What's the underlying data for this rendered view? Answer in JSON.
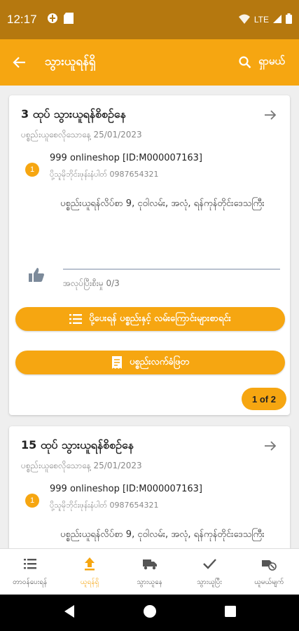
{
  "status_bar": {
    "time": "12:17",
    "network": "LTE"
  },
  "app_bar": {
    "title": "သွားယူရန်ရှိ",
    "search_label": "ရှာမယ်"
  },
  "cards": [
    {
      "title": "3 ထုပ် သွားယူရန်စိစဉ်နေ",
      "date": "ပစ္စည်းယူစေလိုသောနေ့ 25/01/2023",
      "item_number": "1",
      "shop": "999 onlineshop [ID:M000007163]",
      "phone": "ပို့သူမိုဘိုင်းဖုန်းနံပါတ် 0987654321",
      "address": "ပစ္စည်းယူရန်လိပ်စာ 9, ငုဝါလမ်း, အလုံ, ရန်ကုန်တိုင်းဒေသကြီး",
      "progress_label": "အလုပ်ပြီးစီးမှု 0/3",
      "button_list": "ပို့ပေးရန် ပစ္စည်းနှင့် လမ်းကြောင်းများစာရင်း",
      "button_receipt": "ပစ္စည်းလက်ခံဖြတ",
      "page_indicator": "1 of 2"
    },
    {
      "title": "15 ထုပ် သွားယူရန်စိစဉ်နေ",
      "date": "ပစ္စည်းယူစေလိုသောနေ့ 25/01/2023",
      "item_number": "1",
      "shop": "999 onlineshop [ID:M000007163]",
      "phone": "ပို့သူမိုဘိုင်းဖုန်းနံပါတ် 0987654321",
      "address": "ပစ္စည်းယူရန်လိပ်စာ 9, ငုဝါလမ်း, အလုံ, ရန်ကုန်တိုင်းဒေသကြီး"
    }
  ],
  "bottom_nav": [
    {
      "label": "တာဝန်ပေးရန်",
      "icon": "list-icon",
      "active": false
    },
    {
      "label": "ယူရန်ရှိ",
      "icon": "upload-icon",
      "active": true
    },
    {
      "label": "သွားယူနေ",
      "icon": "truck-icon",
      "active": false
    },
    {
      "label": "သွားယူပြီး",
      "icon": "check-icon",
      "active": false
    },
    {
      "label": "ယူမယ်မျက်",
      "icon": "cancel-delivery-icon",
      "active": false
    }
  ],
  "colors": {
    "accent": "#f6a611",
    "status_bar": "#b5780f"
  }
}
